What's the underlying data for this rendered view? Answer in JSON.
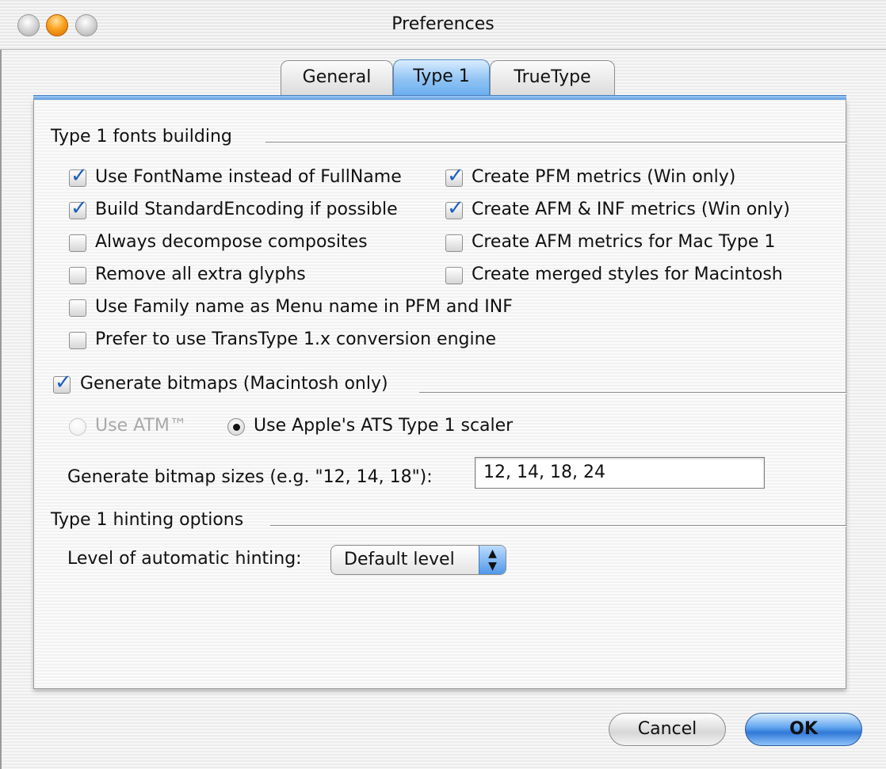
{
  "window": {
    "title": "Preferences"
  },
  "tabs": [
    {
      "label": "General",
      "active": false
    },
    {
      "label": "Type 1",
      "active": true
    },
    {
      "label": "TrueType",
      "active": false
    }
  ],
  "fonts_building": {
    "title": "Type 1 fonts building",
    "options": [
      {
        "label": "Use FontName instead of FullName",
        "checked": true
      },
      {
        "label": "Create PFM metrics (Win only)",
        "checked": true
      },
      {
        "label": "Build StandardEncoding if possible",
        "checked": true
      },
      {
        "label": "Create AFM & INF metrics (Win only)",
        "checked": true
      },
      {
        "label": "Always decompose composites",
        "checked": false
      },
      {
        "label": "Create AFM metrics for Mac Type 1",
        "checked": false
      },
      {
        "label": "Remove all extra glyphs",
        "checked": false
      },
      {
        "label": "Create merged styles for Macintosh",
        "checked": false
      },
      {
        "label": "Use Family name as Menu name in PFM and INF",
        "checked": false
      },
      {
        "label": "Prefer to use TransType 1.x conversion engine",
        "checked": false
      }
    ]
  },
  "bitmaps": {
    "title": "Generate bitmaps (Macintosh only)",
    "checked": true,
    "radio_atm": {
      "label": "Use ATM™",
      "selected": false,
      "enabled": false
    },
    "radio_ats": {
      "label": "Use Apple's ATS Type 1 scaler",
      "selected": true,
      "enabled": true
    },
    "sizes_label": "Generate bitmap sizes (e.g. \"12, 14, 18\"):",
    "sizes_value": "12, 14, 18, 24"
  },
  "hinting": {
    "title": "Type 1 hinting options",
    "level_label": "Level of automatic hinting:",
    "level_value": "Default level"
  },
  "buttons": {
    "cancel": "Cancel",
    "ok": "OK"
  },
  "colors": {
    "accent": "#5e9ee0",
    "check": "#1f5fbf"
  }
}
